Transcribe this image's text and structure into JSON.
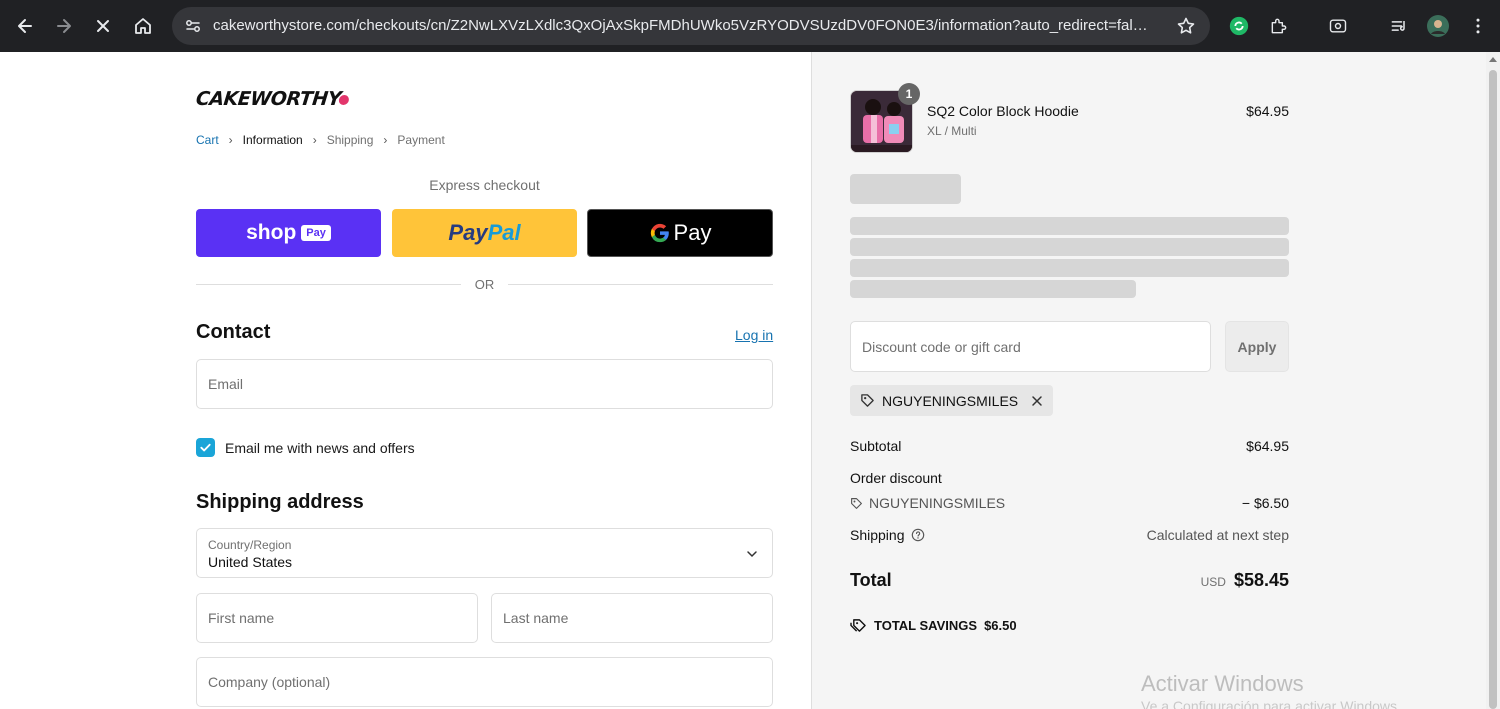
{
  "browser": {
    "url": "cakeworthystore.com/checkouts/cn/Z2NwLXVzLXdlc3QxOjAxSkpFMDhUWko5VzRYODVSUzdDV0FON0E3/information?auto_redirect=false..."
  },
  "store": {
    "logo_text": "CAKEWORTHY"
  },
  "breadcrumb": {
    "cart": "Cart",
    "information": "Information",
    "shipping": "Shipping",
    "payment": "Payment"
  },
  "express": {
    "title": "Express checkout",
    "shop_label": "shop",
    "shop_pay_tag": "Pay",
    "paypal_part1": "Pay",
    "paypal_part2": "Pal",
    "gpay_label": "Pay",
    "or_label": "OR"
  },
  "contact": {
    "heading": "Contact",
    "login_link": "Log in",
    "email_placeholder": "Email",
    "newsletter_label": "Email me with news and offers",
    "newsletter_checked": true
  },
  "shipping": {
    "heading": "Shipping address",
    "country_label": "Country/Region",
    "country_value": "United States",
    "first_name_placeholder": "First name",
    "last_name_placeholder": "Last name",
    "company_placeholder": "Company (optional)"
  },
  "order": {
    "quantity": "1",
    "product_name": "SQ2 Color Block Hoodie",
    "product_variant": "XL / Multi",
    "product_price": "$64.95",
    "discount_placeholder": "Discount code or gift card",
    "apply_label": "Apply",
    "applied_code": "NGUYENINGSMILES",
    "subtotal_label": "Subtotal",
    "subtotal_value": "$64.95",
    "order_discount_label": "Order discount",
    "discount_code": "NGUYENINGSMILES",
    "discount_value": "− $6.50",
    "shipping_label": "Shipping",
    "shipping_value": "Calculated at next step",
    "total_label": "Total",
    "total_currency": "USD",
    "total_value": "$58.45",
    "savings_label": "TOTAL SAVINGS",
    "savings_value": "$6.50"
  },
  "os": {
    "watermark_title": "Activar Windows",
    "watermark_subtitle": "Ve a Configuración para activar Windows."
  },
  "colors": {
    "accent_link": "#1773b0",
    "shop_pay": "#5a31f4",
    "paypal": "#ffc439",
    "checkbox": "#1aa5d8"
  }
}
